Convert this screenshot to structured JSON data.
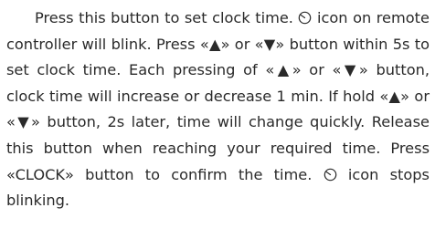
{
  "icons": {
    "clock": "clock-icon"
  },
  "paragraph": {
    "s1": "Press this button to set clock time. ",
    "s2": " icon on remote controller will blink. Press «▲» or «▼» button within 5s to set clock time. Each pressing of «▲» or «▼» button, clock time will increase or decrease 1 min. If hold «▲» or «▼» button, 2s later, time will change quickly. Release this button when reaching your required time. Press «CLOCK» button to confirm the time. ",
    "s3": " icon stops blinking."
  }
}
